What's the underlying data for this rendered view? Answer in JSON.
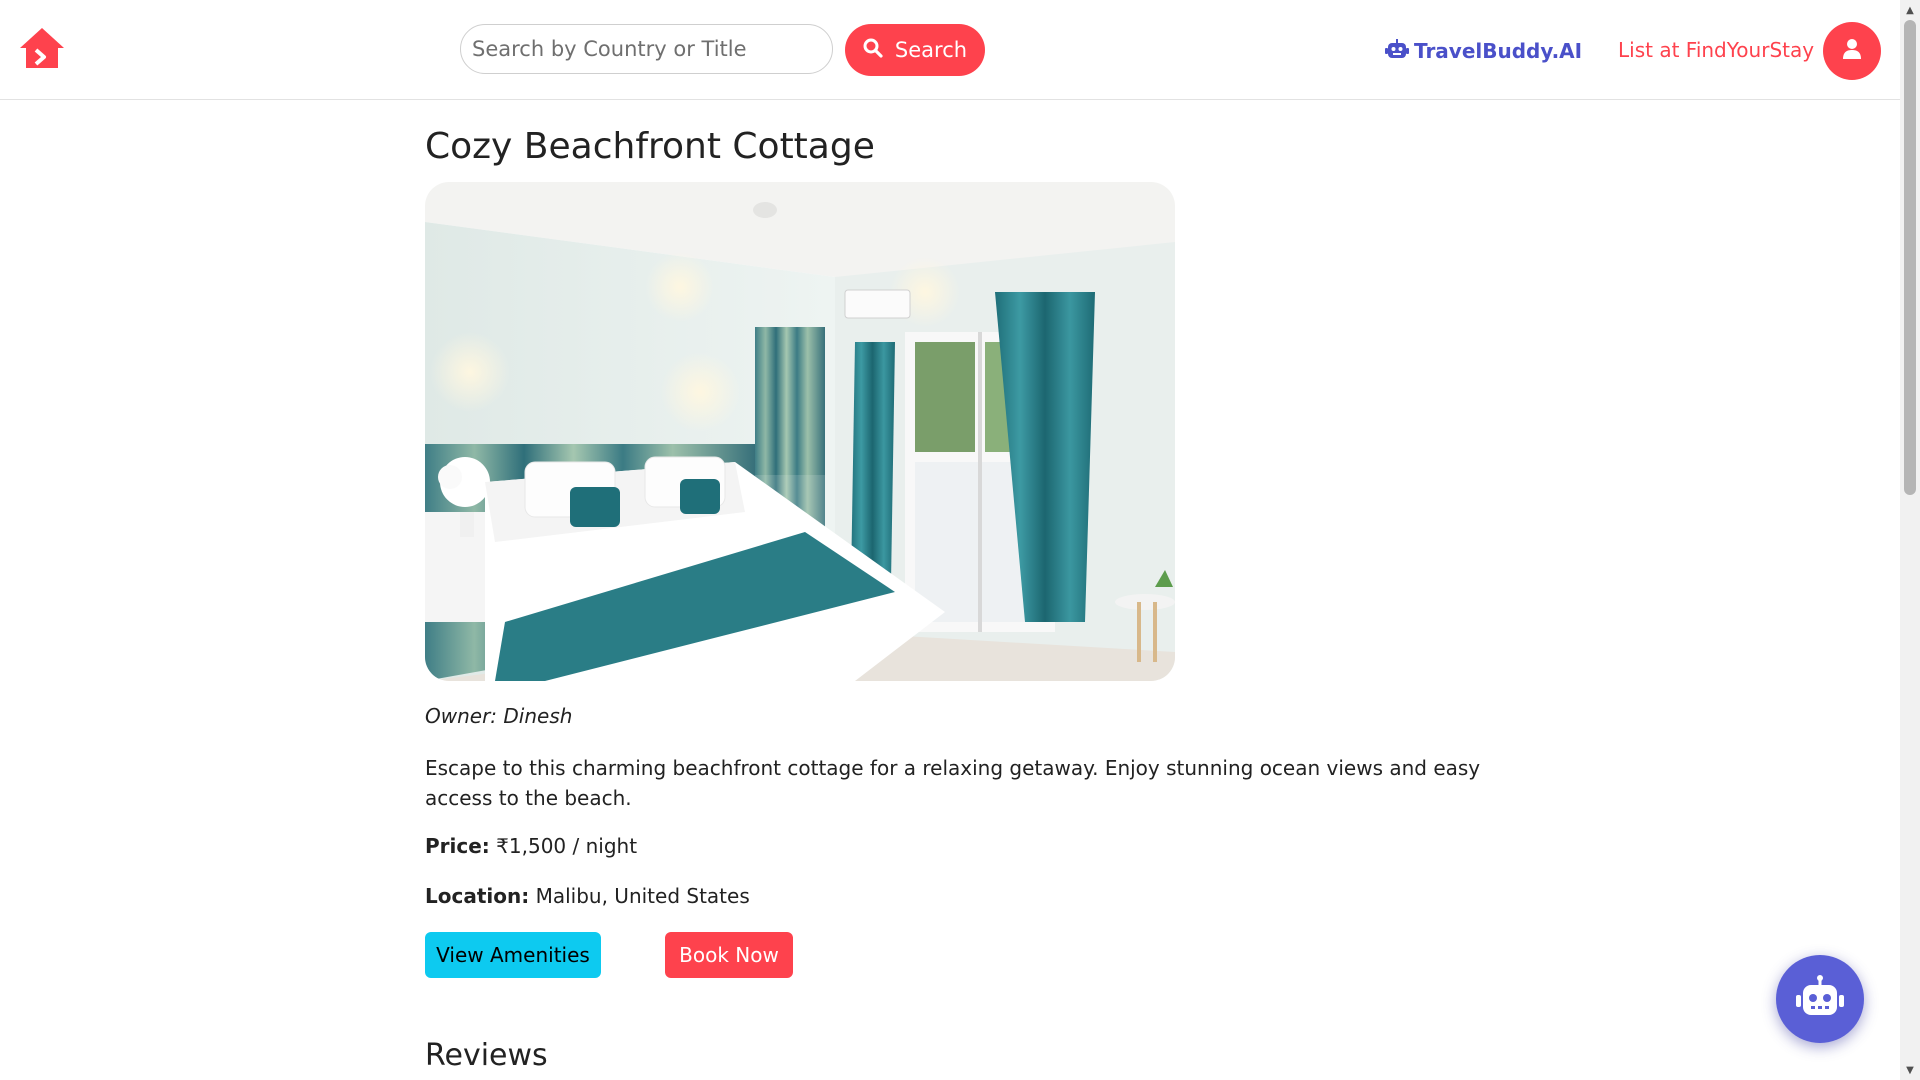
{
  "navbar": {
    "search_placeholder": "Search by Country or Title",
    "search_button_label": "Search",
    "ai_link_label": "TravelBuddy.AI",
    "list_link_label": "List at FindYourStay",
    "brand_color": "#fe424d",
    "ai_color": "#4a50c9"
  },
  "listing": {
    "title": "Cozy Beachfront Cottage",
    "owner": "Owner: Dinesh",
    "description": "Escape to this charming beachfront cottage for a relaxing getaway. Enjoy stunning ocean views and easy access to the beach.",
    "price_label": "Price:",
    "price_value": "₹1,500 / night",
    "location_label": "Location:",
    "location_value": "Malibu, United States"
  },
  "actions": {
    "amenities_label": "View Amenities",
    "book_label": "Book Now"
  },
  "reviews": {
    "heading": "Reviews"
  },
  "icons": {
    "logo": "house-logo-icon",
    "search": "search-icon",
    "ai": "robot-icon",
    "user": "user-icon",
    "chatbot": "robot-icon"
  }
}
